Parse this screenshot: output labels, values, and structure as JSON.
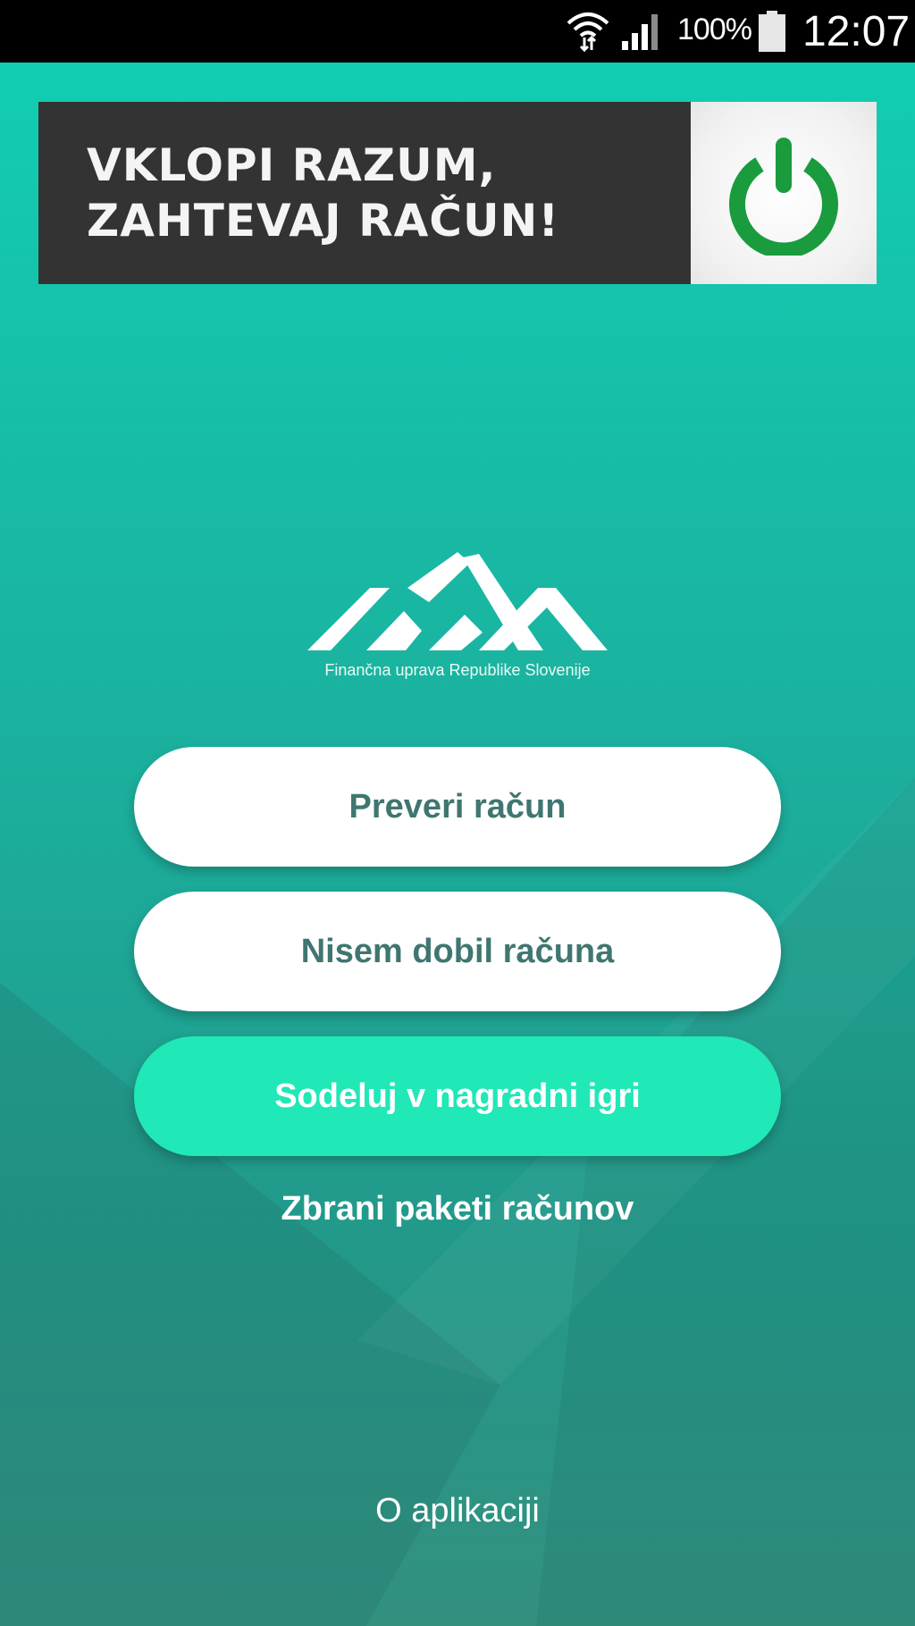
{
  "status_bar": {
    "battery_percent": "100%",
    "time": "12:07",
    "icons": [
      "wifi-icon",
      "cellular-signal-icon",
      "battery-icon"
    ]
  },
  "banner": {
    "line1": "VKLOPI RAZUM,",
    "line2": "ZAHTEVAJ RAČUN!",
    "icon": "power-icon",
    "accent_color": "#1a9b3e"
  },
  "logo": {
    "caption": "Finančna uprava Republike Slovenije"
  },
  "buttons": {
    "check_receipt": "Preveri račun",
    "no_receipt": "Nisem dobil računa",
    "prize_game": "Sodeluj v nagradni igri"
  },
  "links": {
    "collected_packages": "Zbrani paketi računov",
    "about": "O aplikaciji"
  },
  "colors": {
    "background_top": "#12cdb2",
    "background_bottom": "#33907f",
    "button_text": "#3f7670",
    "accent_button": "#20e8b6"
  }
}
